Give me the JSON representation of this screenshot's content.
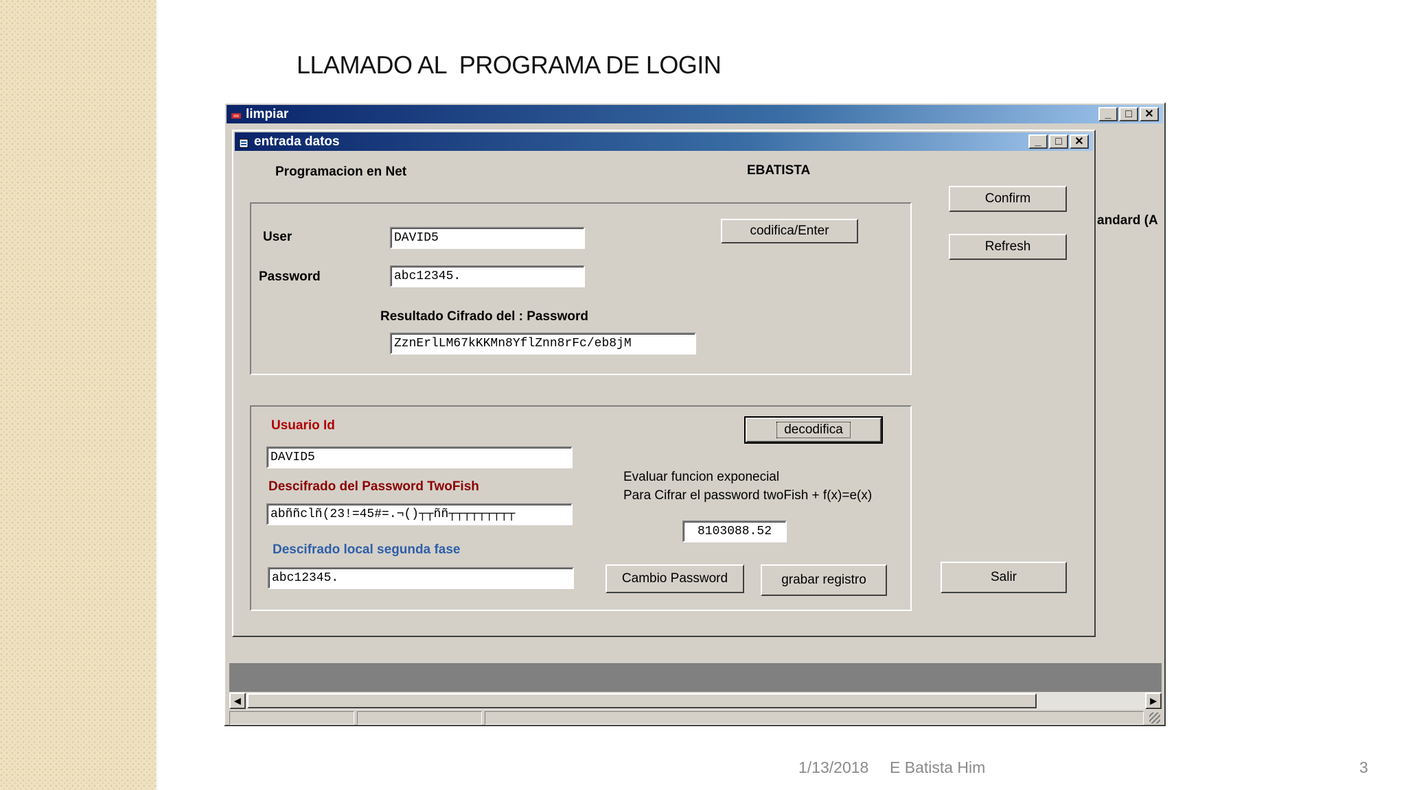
{
  "slide": {
    "title": "LLAMADO AL  PROGRAMA DE LOGIN",
    "footer_date": "1/13/2018",
    "footer_author": "E Batista Him",
    "page_number": "3"
  },
  "outer_window": {
    "title": "limpiar",
    "partial_label": "andard (A"
  },
  "inner_window": {
    "title": "entrada datos",
    "header_left": "Programacion en Net",
    "header_right": "EBATISTA",
    "confirm_label": "Confirm",
    "refresh_label": "Refresh",
    "salir_label": "Salir"
  },
  "login_group": {
    "user_label": "User",
    "user_value": "DAVID5",
    "password_label": "Password",
    "password_value": "abc12345.",
    "codifica_label": "codifica/Enter",
    "result_label": "Resultado Cifrado del : Password",
    "result_value": "ZznErlLM67kKKMn8YflZnn8rFc/eb8jM"
  },
  "decode_group": {
    "usuario_label": "Usuario Id",
    "usuario_value": "DAVID5",
    "descifrado_label": "Descifrado del Password TwoFish",
    "descifrado_value": "abññclñ(23!=45#=.¬()┬┬ññ┬┬┬┬┬┬┬┬┬",
    "local_label": "Descifrado local segunda fase",
    "local_value": "abc12345.",
    "decodifica_label": "decodifica",
    "eval_line1": "Evaluar funcion exponecial",
    "eval_line2": "Para Cifrar el password twoFish + f(x)=e(x)",
    "exp_value": "8103088.52",
    "cambio_label": "Cambio Password",
    "grabar_label": "grabar registro"
  }
}
